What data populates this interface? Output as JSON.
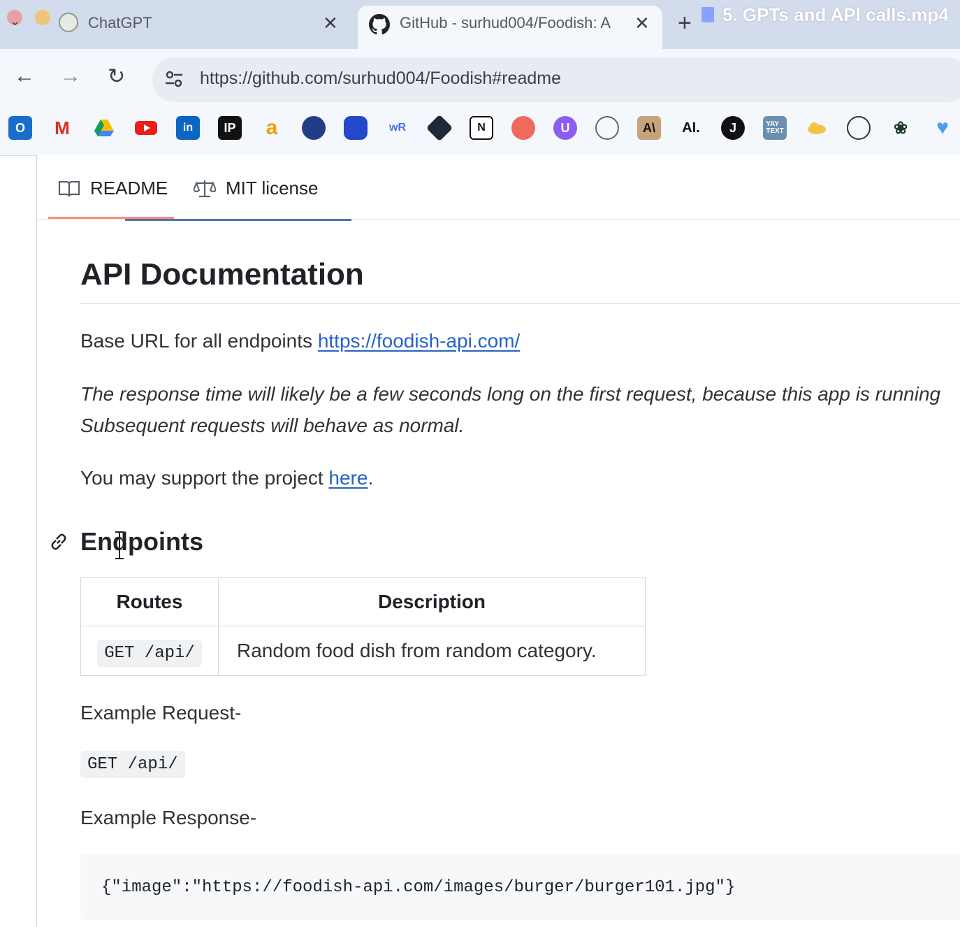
{
  "browser": {
    "tabs": [
      {
        "title": "ChatGPT",
        "active": false
      },
      {
        "title": "GitHub - surhud004/Foodish: A",
        "active": true
      }
    ],
    "video_overlay_title": "5. GPTs and API calls.mp4",
    "url": "https://github.com/surhud004/Foodish#readme",
    "bookmarks": [
      "outlook",
      "gmail",
      "google-drive",
      "youtube",
      "linkedin",
      "ip",
      "a",
      "alien",
      "bot",
      "wr",
      "perplexity",
      "notion",
      "target",
      "u",
      "openai",
      "anthropic",
      "AI.",
      "j",
      "yay-text",
      "cloud",
      "compass",
      "sprout",
      "heart"
    ]
  },
  "readme_tabs": {
    "readme": "README",
    "license": "MIT license"
  },
  "doc": {
    "title": "API Documentation",
    "base_url_label": "Base URL for all endpoints ",
    "base_url_link": "https://foodish-api.com/",
    "notice_line1": "The response time will likely be a few seconds long on the first request, because this app is running",
    "notice_line2": "Subsequent requests will behave as normal.",
    "support_prefix": "You may support the project ",
    "support_link": "here",
    "support_suffix": ".",
    "endpoints_heading": "Endpoints",
    "table": {
      "headers": [
        "Routes",
        "Description"
      ],
      "rows": [
        {
          "route": "GET /api/",
          "description": "Random food dish from random category."
        }
      ]
    },
    "example_request_label": "Example Request-",
    "example_request_code": "GET /api/",
    "example_response_label": "Example Response-",
    "example_response_code": "{\"image\":\"https://foodish-api.com/images/burger/burger101.jpg\"}"
  }
}
